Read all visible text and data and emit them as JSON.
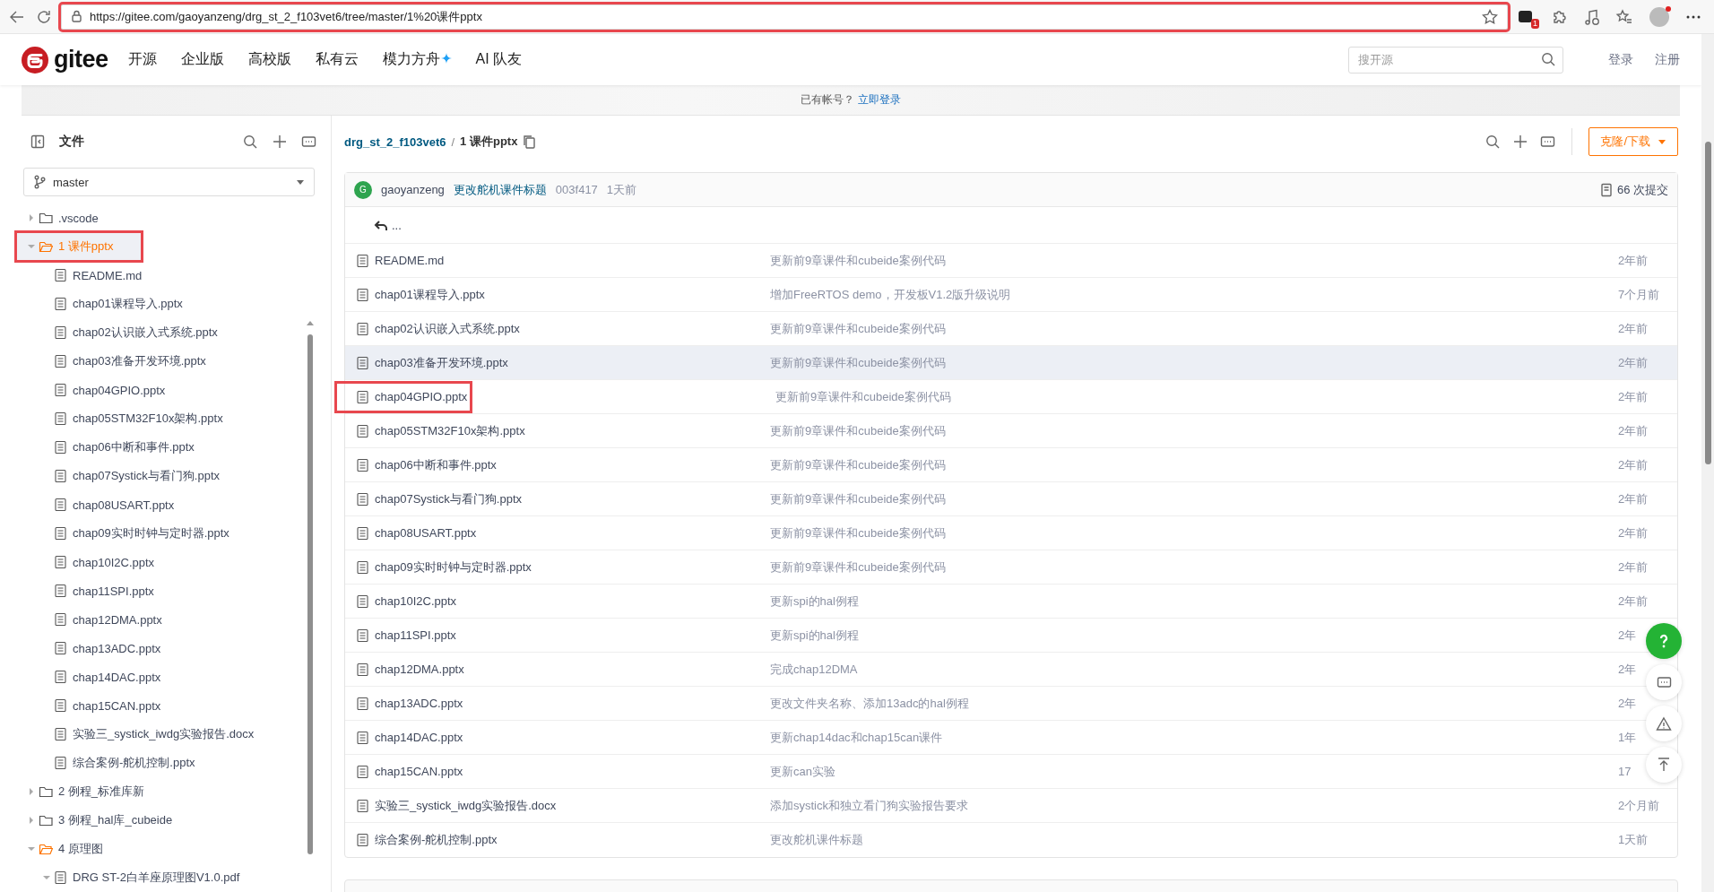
{
  "browser": {
    "url": "https://gitee.com/gaoyanzeng/drg_st_2_f103vet6/tree/master/1%20课件pptx",
    "highlighted": true,
    "extension_badge": "1"
  },
  "header": {
    "logo_text": "gitee",
    "nav": [
      {
        "label": "开源",
        "sparkle": false
      },
      {
        "label": "企业版",
        "sparkle": false
      },
      {
        "label": "高校版",
        "sparkle": false
      },
      {
        "label": "私有云",
        "sparkle": false
      },
      {
        "label": "模力方舟",
        "sparkle": true
      },
      {
        "label": "AI 队友",
        "sparkle": false
      }
    ],
    "search": {
      "placeholder": "搜开源"
    },
    "links": [
      "登录",
      "注册"
    ]
  },
  "banner": {
    "text": "已有帐号？",
    "link": "立即登录"
  },
  "sidebar": {
    "title": "文件",
    "branch": "master",
    "tree": [
      {
        "name": ".vscode",
        "kind": "folder",
        "expanded": false,
        "selected": false,
        "highlighted": false
      },
      {
        "name": "1 课件pptx",
        "kind": "folder",
        "expanded": true,
        "selected": true,
        "highlighted": true,
        "children": [
          {
            "name": "README.md",
            "kind": "file",
            "selected": false,
            "highlighted": false
          },
          {
            "name": "chap01课程导入.pptx",
            "kind": "file",
            "selected": false,
            "highlighted": false
          },
          {
            "name": "chap02认识嵌入式系统.pptx",
            "kind": "file",
            "selected": false,
            "highlighted": false
          },
          {
            "name": "chap03准备开发环境.pptx",
            "kind": "file",
            "selected": false,
            "highlighted": false
          },
          {
            "name": "chap04GPIO.pptx",
            "kind": "file",
            "selected": false,
            "highlighted": false
          },
          {
            "name": "chap05STM32F10x架构.pptx",
            "kind": "file",
            "selected": false,
            "highlighted": false
          },
          {
            "name": "chap06中断和事件.pptx",
            "kind": "file",
            "selected": false,
            "highlighted": false
          },
          {
            "name": "chap07Systick与看门狗.pptx",
            "kind": "file",
            "selected": false,
            "highlighted": false
          },
          {
            "name": "chap08USART.pptx",
            "kind": "file",
            "selected": false,
            "highlighted": false
          },
          {
            "name": "chap09实时时钟与定时器.pptx",
            "kind": "file",
            "selected": false,
            "highlighted": false
          },
          {
            "name": "chap10I2C.pptx",
            "kind": "file",
            "selected": false,
            "highlighted": false
          },
          {
            "name": "chap11SPI.pptx",
            "kind": "file",
            "selected": false,
            "highlighted": false
          },
          {
            "name": "chap12DMA.pptx",
            "kind": "file",
            "selected": false,
            "highlighted": false
          },
          {
            "name": "chap13ADC.pptx",
            "kind": "file",
            "selected": false,
            "highlighted": false
          },
          {
            "name": "chap14DAC.pptx",
            "kind": "file",
            "selected": false,
            "highlighted": false
          },
          {
            "name": "chap15CAN.pptx",
            "kind": "file",
            "selected": false,
            "highlighted": false
          },
          {
            "name": "实验三_systick_iwdg实验报告.docx",
            "kind": "file",
            "selected": false,
            "highlighted": false
          },
          {
            "name": "综合案例-舵机控制.pptx",
            "kind": "file",
            "selected": false,
            "highlighted": false
          }
        ]
      },
      {
        "name": "2 例程_标准库新",
        "kind": "folder",
        "expanded": false,
        "selected": false,
        "highlighted": false
      },
      {
        "name": "3 例程_hal库_cubeide",
        "kind": "folder",
        "expanded": false,
        "selected": false,
        "highlighted": false
      },
      {
        "name": "4 原理图",
        "kind": "folder",
        "expanded": true,
        "selected": false,
        "highlighted": false,
        "children": [
          {
            "name": "DRG ST-2白羊座原理图V1.0.pdf",
            "kind": "file",
            "expanded": true,
            "selected": false,
            "highlighted": false
          }
        ]
      }
    ]
  },
  "breadcrumb": {
    "repo": "drg_st_2_f103vet6",
    "separator": "/",
    "path": "1 课件pptx"
  },
  "clone_button": "克隆/下载",
  "commit": {
    "avatar": "G",
    "author": "gaoyanzeng",
    "message": "更改舵机课件标题",
    "hash": "003f417",
    "time": "1天前",
    "count": "66 次提交"
  },
  "parent_link": "...",
  "files": [
    {
      "name": "README.md",
      "message": "更新前9章课件和cubeide案例代码",
      "date": "2年前",
      "hovered": false,
      "highlighted": false
    },
    {
      "name": "chap01课程导入.pptx",
      "message": "增加FreeRTOS demo，开发板V1.2版升级说明",
      "date": "7个月前",
      "hovered": false,
      "highlighted": false
    },
    {
      "name": "chap02认识嵌入式系统.pptx",
      "message": "更新前9章课件和cubeide案例代码",
      "date": "2年前",
      "hovered": false,
      "highlighted": false
    },
    {
      "name": "chap03准备开发环境.pptx",
      "message": "更新前9章课件和cubeide案例代码",
      "date": "2年前",
      "hovered": true,
      "highlighted": false
    },
    {
      "name": "chap04GPIO.pptx",
      "message": "更新前9章课件和cubeide案例代码",
      "date": "2年前",
      "hovered": false,
      "highlighted": true
    },
    {
      "name": "chap05STM32F10x架构.pptx",
      "message": "更新前9章课件和cubeide案例代码",
      "date": "2年前",
      "hovered": false,
      "highlighted": false
    },
    {
      "name": "chap06中断和事件.pptx",
      "message": "更新前9章课件和cubeide案例代码",
      "date": "2年前",
      "hovered": false,
      "highlighted": false
    },
    {
      "name": "chap07Systick与看门狗.pptx",
      "message": "更新前9章课件和cubeide案例代码",
      "date": "2年前",
      "hovered": false,
      "highlighted": false
    },
    {
      "name": "chap08USART.pptx",
      "message": "更新前9章课件和cubeide案例代码",
      "date": "2年前",
      "hovered": false,
      "highlighted": false
    },
    {
      "name": "chap09实时时钟与定时器.pptx",
      "message": "更新前9章课件和cubeide案例代码",
      "date": "2年前",
      "hovered": false,
      "highlighted": false
    },
    {
      "name": "chap10I2C.pptx",
      "message": "更新spi的hal例程",
      "date": "2年前",
      "hovered": false,
      "highlighted": false
    },
    {
      "name": "chap11SPI.pptx",
      "message": "更新spi的hal例程",
      "date": "2年",
      "hovered": false,
      "highlighted": false
    },
    {
      "name": "chap12DMA.pptx",
      "message": "完成chap12DMA",
      "date": "2年",
      "hovered": false,
      "highlighted": false
    },
    {
      "name": "chap13ADC.pptx",
      "message": "更改文件夹名称、添加13adc的hal例程",
      "date": "2年",
      "hovered": false,
      "highlighted": false
    },
    {
      "name": "chap14DAC.pptx",
      "message": "更新chap14dac和chap15can课件",
      "date": "1年",
      "hovered": false,
      "highlighted": false
    },
    {
      "name": "chap15CAN.pptx",
      "message": "更新can实验",
      "date": "17",
      "hovered": false,
      "highlighted": false
    },
    {
      "name": "实验三_systick_iwdg实验报告.docx",
      "message": "添加systick和独立看门狗实验报告要求",
      "date": "2个月前",
      "hovered": false,
      "highlighted": false
    },
    {
      "name": "综合案例-舵机控制.pptx",
      "message": "更改舵机课件标题",
      "date": "1天前",
      "hovered": false,
      "highlighted": false
    }
  ]
}
